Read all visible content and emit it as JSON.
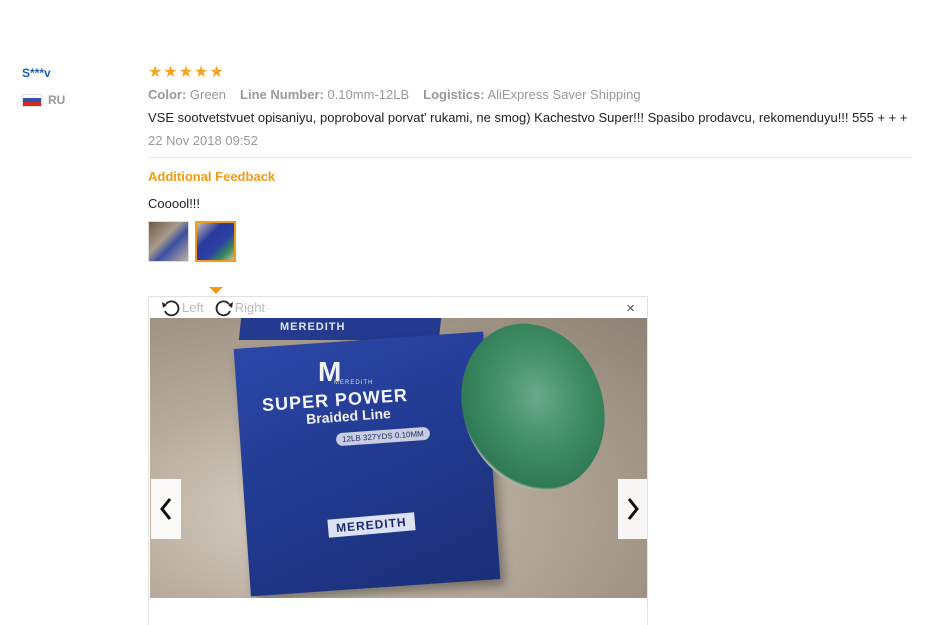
{
  "reviewer": {
    "name": "S***v",
    "country_code": "RU",
    "flag_colors": [
      "#ffffff",
      "#2f52b3",
      "#d52b1e"
    ]
  },
  "review": {
    "rating": 5,
    "stars": [
      "★",
      "★",
      "★",
      "★",
      "★"
    ],
    "attributes": [
      {
        "label": "Color:",
        "value": "Green"
      },
      {
        "label": "Line Number:",
        "value": "0.10mm-12LB"
      },
      {
        "label": "Logistics:",
        "value": "AliExpress Saver Shipping"
      }
    ],
    "text": "VSE sootvetstvuet opisaniyu, poproboval porvat' rukami, ne smog) Kachestvo Super!!! Spasibo prodavcu, rekomenduyu!!! 555 + + +",
    "date": "22 Nov 2018 09:52"
  },
  "additional": {
    "title": "Additional Feedback",
    "text": "Cooool!!!"
  },
  "viewer": {
    "rotate_left_label": "Left",
    "rotate_right_label": "Right",
    "close_symbol": "×",
    "active_photo_index": 1,
    "photo_count": 2,
    "photo_text": {
      "brand_top": "MEREDITH",
      "logo": "M",
      "logo_sub": "MEREDITH",
      "headline": "SUPER POWER",
      "subline": "Braided Line",
      "spec": "12LB 327YDS 0.10MM",
      "brand_bottom": "MEREDITH"
    }
  },
  "colors": {
    "accent_orange": "#f39c12",
    "star": "#f5a623",
    "reviewer_blue": "#1a5fb4",
    "muted": "#999999"
  }
}
